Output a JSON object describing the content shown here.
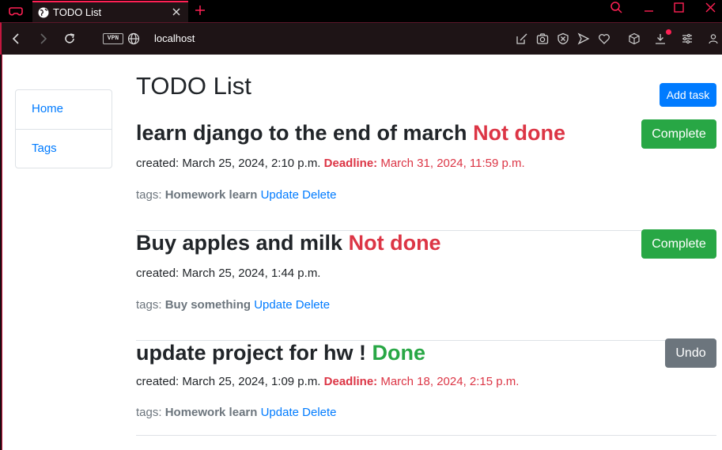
{
  "browser": {
    "tab_title": "TODO List",
    "vpn_label": "VPN",
    "url": "localhost"
  },
  "sidebar": {
    "items": [
      {
        "label": "Home"
      },
      {
        "label": "Tags"
      }
    ]
  },
  "main": {
    "title": "TODO List",
    "add_task_label": "Add task"
  },
  "tasks": [
    {
      "title": "learn django to the end of march",
      "status": "Not done",
      "created_label": "created:",
      "created": "March 25, 2024, 2:10 p.m.",
      "deadline_label": "Deadline:",
      "deadline": "March 31, 2024, 11:59 p.m.",
      "tags_label": "tags:",
      "tags": "Homework learn",
      "update_label": "Update",
      "delete_label": "Delete",
      "action_label": "Complete"
    },
    {
      "title": "Buy apples and milk",
      "status": "Not done",
      "created_label": "created:",
      "created": "March 25, 2024, 1:44 p.m.",
      "tags_label": "tags:",
      "tags": "Buy something",
      "update_label": "Update",
      "delete_label": "Delete",
      "action_label": "Complete"
    },
    {
      "title": "update project for hw !",
      "status": "Done",
      "created_label": "created:",
      "created": "March 25, 2024, 1:09 p.m.",
      "deadline_label": "Deadline:",
      "deadline": "March 18, 2024, 2:15 p.m.",
      "tags_label": "tags:",
      "tags": "Homework learn",
      "update_label": "Update",
      "delete_label": "Delete",
      "action_label": "Undo"
    }
  ],
  "colors": {
    "accent": "#ff2054",
    "link": "#007bff",
    "success": "#28a745",
    "danger": "#dc3545",
    "secondary": "#6c757d"
  }
}
